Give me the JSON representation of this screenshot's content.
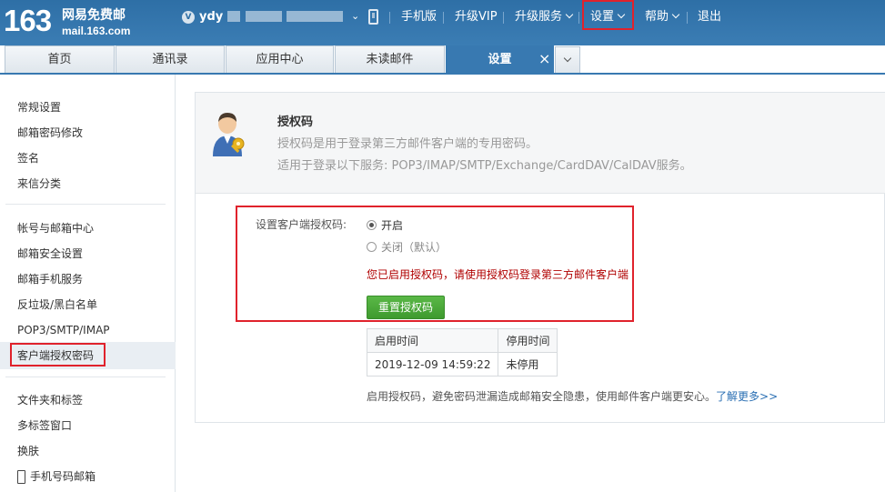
{
  "header": {
    "logo_number": "163",
    "logo_name": "网易免费邮",
    "logo_domain": "mail.163.com",
    "vip_badge": "V",
    "user_name": "ydy",
    "nav": [
      "手机版",
      "升级VIP",
      "升级服务",
      "设置",
      "帮助",
      "退出"
    ]
  },
  "tabs": [
    {
      "label": "首页"
    },
    {
      "label": "通讯录"
    },
    {
      "label": "应用中心"
    },
    {
      "label": "未读邮件"
    },
    {
      "label": "设置"
    }
  ],
  "tab_close": "×",
  "sidebar": {
    "group1": [
      "常规设置",
      "邮箱密码修改",
      "签名",
      "来信分类"
    ],
    "group2": [
      "帐号与邮箱中心",
      "邮箱安全设置",
      "邮箱手机服务",
      "反垃圾/黑白名单",
      "POP3/SMTP/IMAP",
      "客户端授权密码"
    ],
    "group3": [
      "文件夹和标签",
      "多标签窗口",
      "换肤",
      "手机号码邮箱"
    ],
    "active": "客户端授权密码"
  },
  "auth": {
    "title": "授权码",
    "desc1": "授权码是用于登录第三方邮件客户端的专用密码。",
    "desc2": "适用于登录以下服务: POP3/IMAP/SMTP/Exchange/CardDAV/CalDAV服务。",
    "setting_label": "设置客户端授权码:",
    "option_on": "开启",
    "option_off": "关闭（默认）",
    "selected": "开启",
    "notice": "您已启用授权码，请使用授权码登录第三方邮件客户端",
    "reset_button": "重置授权码",
    "table": {
      "headers": [
        "启用时间",
        "停用时间"
      ],
      "row": [
        "2019-12-09 14:59:22",
        "未停用"
      ]
    },
    "footer_text": "启用授权码，避免密码泄漏造成邮箱安全隐患，使用邮件客户端更安心。",
    "footer_link": "了解更多>>"
  }
}
